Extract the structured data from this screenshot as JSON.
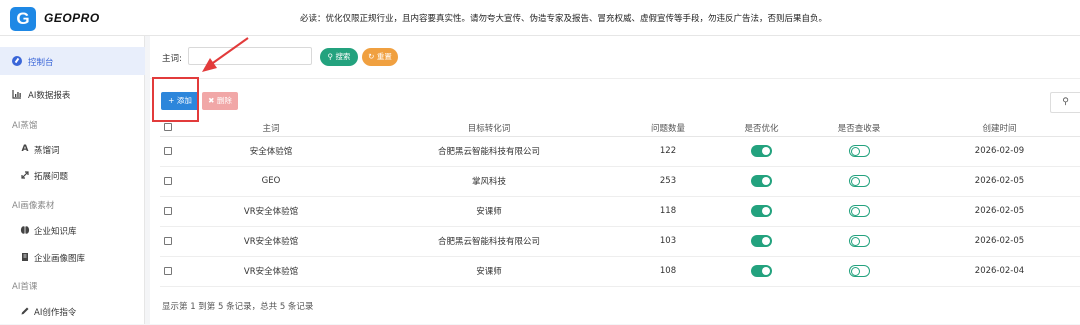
{
  "header": {
    "logo_letter": "G",
    "brand": "GEOPRO",
    "notice": "必读：优化仅限正规行业，且内容要真实性。请勿夸大宣传、伪造专家及报告、冒充权威、虚假宣传等手段，勿违反广告法，否则后果自负。"
  },
  "sidebar": {
    "items": [
      {
        "label": "控制台",
        "icon": "dashboard-icon"
      },
      {
        "label": "AI数据报表",
        "icon": "chart-icon"
      }
    ],
    "sections": [
      {
        "title": "AI蒸馏",
        "items": [
          {
            "label": "蒸馏词",
            "icon": "text-icon"
          },
          {
            "label": "拓展问题",
            "icon": "expand-icon"
          }
        ]
      },
      {
        "title": "AI画像素材",
        "items": [
          {
            "label": "企业知识库",
            "icon": "brain-icon"
          },
          {
            "label": "企业画像图库",
            "icon": "document-icon"
          }
        ]
      },
      {
        "title": "AI首课",
        "items": [
          {
            "label": "AI创作指令",
            "icon": "pen-icon"
          }
        ]
      }
    ]
  },
  "search": {
    "label": "主词:",
    "value": "",
    "search_button": "搜索",
    "reset_button": "重置"
  },
  "toolbar": {
    "add_button": "添加",
    "delete_button": "删除"
  },
  "table": {
    "columns": [
      "主词",
      "目标转化词",
      "问题数量",
      "是否优化",
      "是否查收录",
      "创建时间"
    ],
    "rows": [
      {
        "main": "安全体验馆",
        "target": "合肥黑云智能科技有限公司",
        "count": "122",
        "optimized": true,
        "indexed": false,
        "created": "2026-02-09"
      },
      {
        "main": "GEO",
        "target": "掌风科技",
        "count": "253",
        "optimized": true,
        "indexed": false,
        "created": "2026-02-05"
      },
      {
        "main": "VR安全体验馆",
        "target": "安课师",
        "count": "118",
        "optimized": true,
        "indexed": false,
        "created": "2026-02-05"
      },
      {
        "main": "VR安全体验馆",
        "target": "合肥黑云智能科技有限公司",
        "count": "103",
        "optimized": true,
        "indexed": false,
        "created": "2026-02-05"
      },
      {
        "main": "VR安全体验馆",
        "target": "安课师",
        "count": "108",
        "optimized": true,
        "indexed": false,
        "created": "2026-02-04"
      }
    ]
  },
  "pagination": {
    "summary": "显示第 1 到第 5 条记录，总共 5 条记录"
  },
  "colors": {
    "primary": "#2d86db",
    "success": "#23a27e",
    "warning": "#f0a040",
    "danger_light": "#f1a7a7",
    "annotation": "#e23b3b"
  }
}
